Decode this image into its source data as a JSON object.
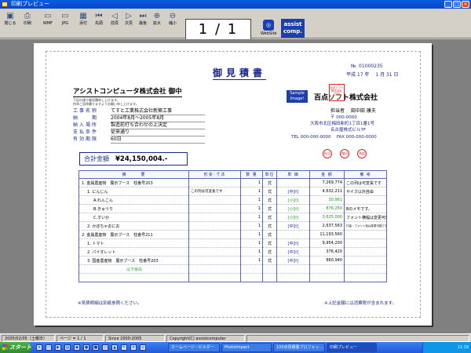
{
  "window": {
    "title": "印刷プレビュー",
    "minimize": "_",
    "maximize": "□",
    "close": "×"
  },
  "toolbar": {
    "buttons": [
      {
        "label": "閉じる",
        "icon": "door-icon",
        "glyph": "▣"
      },
      {
        "label": "印刷",
        "icon": "printer-icon",
        "glyph": "⎙"
      },
      {
        "label": "WMF",
        "icon": "wmf-icon",
        "glyph": "▭"
      },
      {
        "label": "JPG",
        "icon": "jpg-icon",
        "glyph": "▭"
      },
      {
        "label": "添付",
        "icon": "attach-icon",
        "glyph": "▦"
      },
      {
        "label": "先頭",
        "icon": "first-page-icon",
        "glyph": "⏮"
      },
      {
        "label": "前頁",
        "icon": "prev-page-icon",
        "glyph": "◁"
      },
      {
        "label": "次頁",
        "icon": "next-page-icon",
        "glyph": "▷"
      },
      {
        "label": "最後",
        "icon": "last-page-icon",
        "glyph": "⏭"
      },
      {
        "label": "拡大",
        "icon": "zoom-in-icon",
        "glyph": "⊕"
      },
      {
        "label": "縮小",
        "icon": "zoom-out-icon",
        "glyph": "⊖"
      }
    ],
    "page_indicator": "1 / 1",
    "website_label": "WebSite",
    "assist_line1": "assist",
    "assist_line2": "comp."
  },
  "doc": {
    "title": "御見積書",
    "no": "№. 01000235",
    "date": "平成 17 年 　1 月 31 日",
    "customer": "アシストコンピュータ株式会社 御中",
    "notes": [
      "下記の通り御見積申し上げます。",
      "何卒ご用命賜りますようお願い申し上げます。"
    ],
    "info": [
      {
        "key": "工事名称",
        "value": "てすと工業株式会社新築工事"
      },
      {
        "key": "納　　期",
        "value": "2004年8月～2005年8月"
      },
      {
        "key": "納入場所",
        "value": "製造前打ち合わせの上決定"
      },
      {
        "key": "支払条件",
        "value": "従来通り"
      },
      {
        "key": "有効期限",
        "value": "60日"
      }
    ],
    "sample_label": "Sample Image!",
    "company": "百点ソフト株式会社",
    "stamp_text": "百点ソフト株式会社 之印",
    "rep": "担当者　 田中田 康夫",
    "postal": "〒 000-0000",
    "address1": "大阪市北区梅田新町1丁目1番1号",
    "address2": "名古屋株式ビル7F",
    "tel_fax": "TEL 000-000-0000　 FAX 000-000-0000",
    "seals": [
      "担当",
      "検印",
      "承認"
    ],
    "total_label": "合計金額",
    "total_value": "¥24,150,004.-",
    "headers": [
      "摘　　　要",
      "形状･寸法",
      "数 量",
      "単位",
      "単 価",
      "金 額",
      "備 考"
    ],
    "rows": [
      {
        "desc": "1. 金属農産物　展示ブース　柱番号203",
        "shape": "",
        "qty": "1",
        "unit": "式",
        "price": "",
        "amount": "7,269,774",
        "note": "この列は可変長です",
        "indent": 0,
        "pgreen": false
      },
      {
        "desc": "1. にんじん",
        "shape": "この列は可変長です",
        "qty": "1",
        "unit": "式",
        "price": "[中計]",
        "amount": "4,632,211",
        "note": "サイズ以外自由",
        "indent": 1,
        "pgreen": false
      },
      {
        "desc": "A.れんこん",
        "shape": "",
        "qty": "1",
        "unit": "式",
        "price": "[小計]",
        "amount": "30,961",
        "note": "",
        "indent": 2,
        "pgreen": true
      },
      {
        "desc": "B.きゅうり",
        "shape": "",
        "qty": "1",
        "unit": "式",
        "price": "[小計]",
        "amount": "876,250",
        "note": "Bのメモです。",
        "indent": 2,
        "pgreen": true
      },
      {
        "desc": "C.すいか",
        "shape": "",
        "qty": "1",
        "unit": "式",
        "price": "[小計]",
        "amount": "3,625,000",
        "note": "フォント横幅は変更可能です",
        "indent": 2,
        "pgreen": true
      },
      {
        "desc": "2. かぼちゃおにお",
        "shape": "",
        "qty": "1",
        "unit": "式",
        "price": "[中計]",
        "amount": "2,637,563",
        "note": "行高・フォント色は変更可能です。",
        "indent": 1,
        "pgreen": false
      },
      {
        "desc": "2. 金属農産物　展示ブース　柱番号211",
        "shape": "",
        "qty": "1",
        "unit": "式",
        "price": "",
        "amount": "11,193,560",
        "note": "",
        "indent": 0,
        "pgreen": false
      },
      {
        "desc": "1. トマト",
        "shape": "",
        "qty": "1",
        "unit": "式",
        "price": "[中計]",
        "amount": "9,954,200",
        "note": "",
        "indent": 1,
        "pgreen": false
      },
      {
        "desc": "2. パイオレット",
        "shape": "",
        "qty": "1",
        "unit": "式",
        "price": "[中計]",
        "amount": "376,420",
        "note": "",
        "indent": 1,
        "pgreen": false
      },
      {
        "desc": "3. 国産農産物　展示ブース　柱番号203",
        "shape": "",
        "qty": "1",
        "unit": "式",
        "price": "[中計]",
        "amount": "860,940",
        "note": "",
        "indent": 1,
        "pgreen": false
      },
      {
        "desc": "以下余白",
        "shape": "",
        "qty": "",
        "unit": "",
        "price": "",
        "amount": "",
        "note": "",
        "indent": 3,
        "pgreen": false
      },
      {
        "desc": "",
        "shape": "",
        "qty": "",
        "unit": "",
        "price": "",
        "amount": "",
        "note": "",
        "indent": 0,
        "pgreen": false
      }
    ],
    "footnote_left": "※見積明細は別紙参照ください。",
    "footnote_right": "※上記金額には消費税が含まれます。"
  },
  "status": {
    "date": "2005/02/05（土曜日）",
    "page": "ページ = 1 / 1",
    "since": "Since 2000-2005",
    "copyright": "Copyright(C) assistcomputer"
  },
  "taskbar": {
    "start": "スタート",
    "tasks": [
      "ホームページ・ビルダー",
      "PhotoImpact",
      "100点見積書ブロフェッ...",
      "印刷プレビュー"
    ],
    "time": "11:19"
  },
  "colors": {
    "accent": "#1a2a8c",
    "green": "#1a9a1a",
    "stamp": "#d22222",
    "titlebar": "#0a5ae0"
  }
}
